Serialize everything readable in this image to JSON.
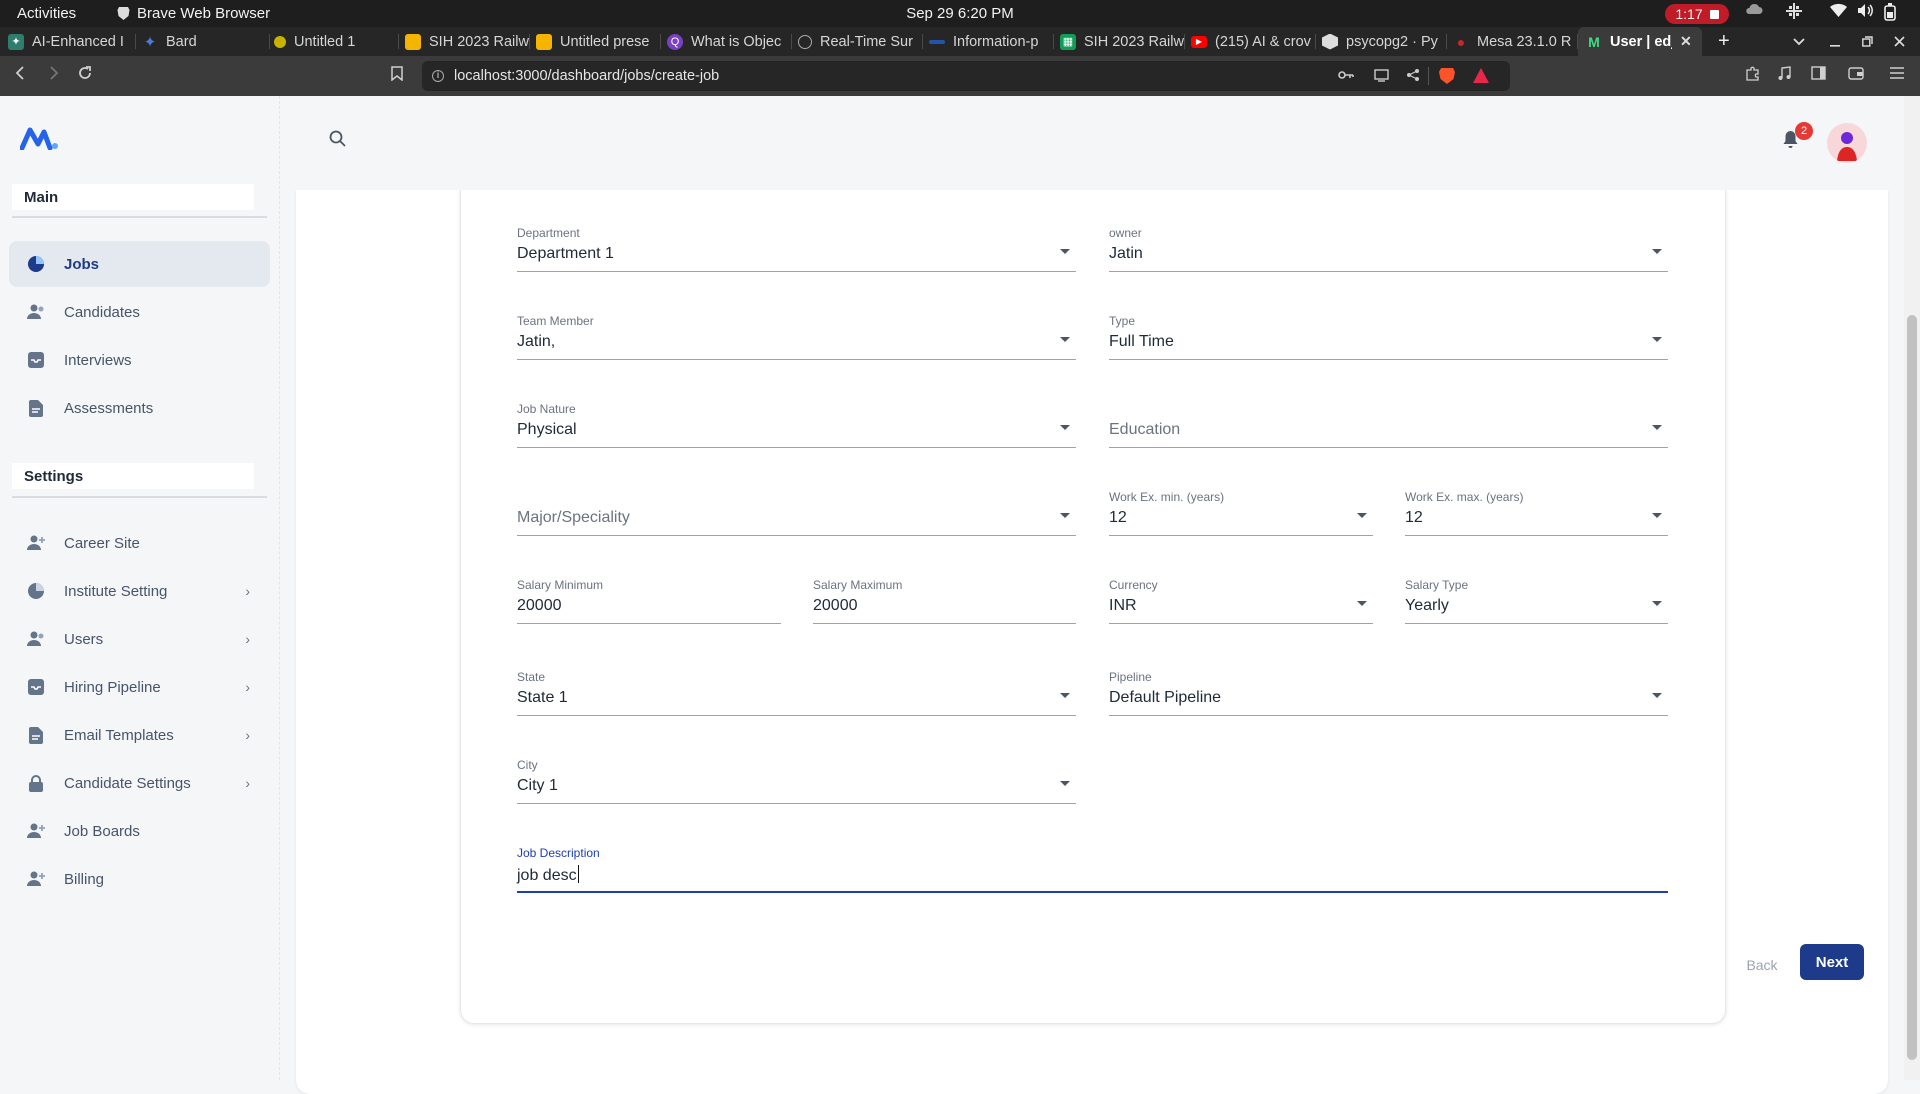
{
  "os_bar": {
    "activities": "Activities",
    "app_name": "Brave Web Browser",
    "clock": "Sep 29  6:20 PM",
    "recording_time": "1:17"
  },
  "tabs": [
    {
      "label": "AI-Enhanced I",
      "favicon": "ai-icon",
      "color": "#2e7d6f"
    },
    {
      "label": "Bard",
      "favicon": "bard-icon",
      "color": "#4a7bd6"
    },
    {
      "label": "Untitled 1",
      "favicon": "chat-icon",
      "color": "#c7b200"
    },
    {
      "label": "SIH 2023 Railw",
      "favicon": "slides-icon",
      "color": "#f4b400"
    },
    {
      "label": "Untitled prese",
      "favicon": "slides-icon",
      "color": "#f4b400"
    },
    {
      "label": "What is Objec",
      "favicon": "quora-icon",
      "color": "#7b3fc4"
    },
    {
      "label": "Real-Time Sur",
      "favicon": "globe-icon",
      "color": "#888888"
    },
    {
      "label": "Information-p",
      "favicon": "site-icon",
      "color": "#2255aa"
    },
    {
      "label": "SIH 2023 Railw",
      "favicon": "sheets-icon",
      "color": "#0f9d58"
    },
    {
      "label": "(215) AI & crov",
      "favicon": "youtube-icon",
      "color": "#ff0000"
    },
    {
      "label": "psycopg2 · Py",
      "favicon": "package-icon",
      "color": "#dddddd"
    },
    {
      "label": "Mesa 23.1.0 R",
      "favicon": "mesa-icon",
      "color": "#c62828"
    },
    {
      "label": "User | edj",
      "favicon": "app-logo-icon",
      "color": "#3ddc84"
    }
  ],
  "address": {
    "url": "localhost:3000/dashboard/jobs/create-job"
  },
  "sidebar": {
    "main_heading": "Main",
    "settings_heading": "Settings",
    "main_items": [
      {
        "label": "Jobs",
        "icon": "pie-chart-icon"
      },
      {
        "label": "Candidates",
        "icon": "users-icon"
      },
      {
        "label": "Interviews",
        "icon": "inbox-icon"
      },
      {
        "label": "Assessments",
        "icon": "document-icon"
      }
    ],
    "settings_items": [
      {
        "label": "Career Site",
        "icon": "user-plus-icon"
      },
      {
        "label": "Institute Setting",
        "icon": "pie-chart-icon"
      },
      {
        "label": "Users",
        "icon": "users-icon"
      },
      {
        "label": "Hiring Pipeline",
        "icon": "inbox-icon"
      },
      {
        "label": "Email Templates",
        "icon": "document-icon"
      },
      {
        "label": "Candidate Settings",
        "icon": "lock-icon"
      },
      {
        "label": "Job Boards",
        "icon": "user-plus-icon"
      },
      {
        "label": "Billing",
        "icon": "user-plus-icon"
      }
    ]
  },
  "header": {
    "notification_count": "2"
  },
  "form": {
    "department": {
      "label": "Department",
      "value": "Department 1"
    },
    "owner": {
      "label": "owner",
      "value": "Jatin"
    },
    "team_member": {
      "label": "Team Member",
      "value": "Jatin,"
    },
    "type": {
      "label": "Type",
      "value": "Full Time"
    },
    "job_nature": {
      "label": "Job Nature",
      "value": "Physical"
    },
    "education": {
      "placeholder": "Education"
    },
    "major": {
      "placeholder": "Major/Speciality"
    },
    "work_ex_min": {
      "label": "Work Ex. min. (years)",
      "value": "12"
    },
    "work_ex_max": {
      "label": "Work Ex. max. (years)",
      "value": "12"
    },
    "salary_min": {
      "label": "Salary Minimum",
      "value": "20000"
    },
    "salary_max": {
      "label": "Salary Maximum",
      "value": "20000"
    },
    "currency": {
      "label": "Currency",
      "value": "INR"
    },
    "salary_type": {
      "label": "Salary Type",
      "value": "Yearly"
    },
    "state": {
      "label": "State",
      "value": "State 1"
    },
    "pipeline": {
      "label": "Pipeline",
      "value": "Default Pipeline"
    },
    "city": {
      "label": "City",
      "value": "City 1"
    },
    "job_description": {
      "label": "Job Description",
      "value": "job desc"
    }
  },
  "actions": {
    "back": "Back",
    "next": "Next"
  },
  "colors": {
    "accent": "#1e3a8a",
    "focus": "#1e40af",
    "badge": "#e53935"
  }
}
